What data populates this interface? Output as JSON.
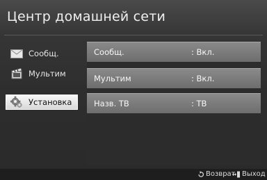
{
  "header": {
    "title": "Центр домашней сети"
  },
  "sidebar": {
    "items": [
      {
        "label": "Сообщ.",
        "icon": "envelope-icon",
        "selected": false
      },
      {
        "label": "Мультим",
        "icon": "film-icon",
        "selected": false
      },
      {
        "label": "Установка",
        "icon": "gear-icon",
        "selected": true
      }
    ]
  },
  "settings": {
    "rows": [
      {
        "label": "Сообщ.",
        "value": ": Вкл."
      },
      {
        "label": "Мультим",
        "value": ": Вкл."
      },
      {
        "label": "Назв. ТВ",
        "value": ": ТВ"
      }
    ]
  },
  "footer": {
    "return_label": "Возврат",
    "return_icon": "return-arrow-icon",
    "exit_label": "Выход",
    "exit_icon": "exit-icon"
  },
  "colors": {
    "selected_bg": "#f0f0f0",
    "row_bg": "#7c7c7c",
    "header_bg": "#404040"
  }
}
